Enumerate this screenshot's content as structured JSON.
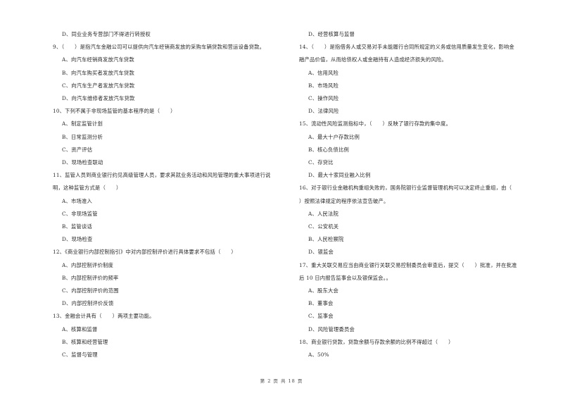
{
  "left_column": {
    "lines": [
      {
        "kind": "opt",
        "text": "D、同业业务专营部门不得进行转授权"
      },
      {
        "kind": "q",
        "text": "9、（　　）是指汽车金融公司可以提供向汽车经销商发放的采购车辆贷款和营运设备贷款。"
      },
      {
        "kind": "opt",
        "text": "A、向汽车经销商发放汽车贷款"
      },
      {
        "kind": "opt",
        "text": "B、向汽车购买者发放汽车贷款"
      },
      {
        "kind": "opt",
        "text": "C、向汽车生产者发放汽车贷款"
      },
      {
        "kind": "opt",
        "text": "D、向汽车维修者发放汽车贷款"
      },
      {
        "kind": "q",
        "text": "10、下列不属于非现场监管的基本程序的是（　　）"
      },
      {
        "kind": "opt",
        "text": "A、制定监管计划"
      },
      {
        "kind": "opt",
        "text": "B、日常监测分析"
      },
      {
        "kind": "opt",
        "text": "C、资产评估"
      },
      {
        "kind": "opt",
        "text": "D、现场检查联动"
      },
      {
        "kind": "q",
        "text": "11、监管人员到商业银行约见高级管理人员，要求其就业务活动和风险管理的重大事项进行说"
      },
      {
        "kind": "qc",
        "text": "明，这种监管方式是（　　）"
      },
      {
        "kind": "opt",
        "text": "A、市场准入"
      },
      {
        "kind": "opt",
        "text": "C、非现场监管"
      },
      {
        "kind": "opt",
        "text": "B、监管谈话"
      },
      {
        "kind": "opt",
        "text": "D、现场检查"
      },
      {
        "kind": "q",
        "text": "12、《商业银行内部控制指引》中对内部控制评价进行具体要求不包括（　　）"
      },
      {
        "kind": "opt",
        "text": "A、内部控制评价制度"
      },
      {
        "kind": "opt",
        "text": "B、内部控制评价的频率"
      },
      {
        "kind": "opt",
        "text": "C、内部控制评价的范围"
      },
      {
        "kind": "opt",
        "text": "D、内部控制评价反馈"
      },
      {
        "kind": "q",
        "text": "13、金融会计具有（　　）两项主要功能。"
      },
      {
        "kind": "opt",
        "text": "A、核算和监督"
      },
      {
        "kind": "opt",
        "text": "B、核算和经营管理"
      },
      {
        "kind": "opt",
        "text": "C、监督与管理"
      }
    ]
  },
  "right_column": {
    "lines": [
      {
        "kind": "opt",
        "text": "D、经营核算与监督"
      },
      {
        "kind": "q",
        "text": "14、（　　）是指借务人或交易对手未能履行合同所规定的义务或信用质量发生变化，影响金"
      },
      {
        "kind": "qc",
        "text": "融产品价值，从而给债权人或金融持有人造成经济损失的风险。"
      },
      {
        "kind": "opt",
        "text": "A、信用风险"
      },
      {
        "kind": "opt",
        "text": "B、市场风险"
      },
      {
        "kind": "opt",
        "text": "C、操作风险"
      },
      {
        "kind": "opt",
        "text": "D、法律风险"
      },
      {
        "kind": "q",
        "text": "15、流动性风险监测指标中，（　　）反映了银行存款的集中度。"
      },
      {
        "kind": "opt",
        "text": "A、最大十户存款比例"
      },
      {
        "kind": "opt",
        "text": "B、核心负债比例"
      },
      {
        "kind": "opt",
        "text": "C、存贷比"
      },
      {
        "kind": "opt",
        "text": "D、最大十家同业融入比例"
      },
      {
        "kind": "q",
        "text": "16、对于银行业金融机构重组失败的，国务院银行业监督管理机构可以决定终止重组，由（"
      },
      {
        "kind": "qc",
        "text": "）按照法律规定的程序依法宣告破产。"
      },
      {
        "kind": "opt",
        "text": "A、人民法院"
      },
      {
        "kind": "opt",
        "text": "C、公安机关"
      },
      {
        "kind": "opt",
        "text": "B、人民检察院"
      },
      {
        "kind": "opt",
        "text": "D、银监会"
      },
      {
        "kind": "q",
        "text": "17、重大关联交易应当由商业银行关联交易控制委员会审查后，提交（　　）批准，并在批准"
      },
      {
        "kind": "qc",
        "text": "后 10 日内报告监事会以及银保监会。。"
      },
      {
        "kind": "opt",
        "text": "A、股东大会"
      },
      {
        "kind": "opt",
        "text": "B、董事会"
      },
      {
        "kind": "opt",
        "text": "C、监事会"
      },
      {
        "kind": "opt",
        "text": "D、风险管理委员会"
      },
      {
        "kind": "q",
        "text": "18、商业银行贷款，贷款余额与存款余额的比例不得超过（　　）"
      },
      {
        "kind": "opt",
        "text": "A、50%"
      }
    ]
  },
  "footer": {
    "text": "第 2 页 共 18 页"
  }
}
